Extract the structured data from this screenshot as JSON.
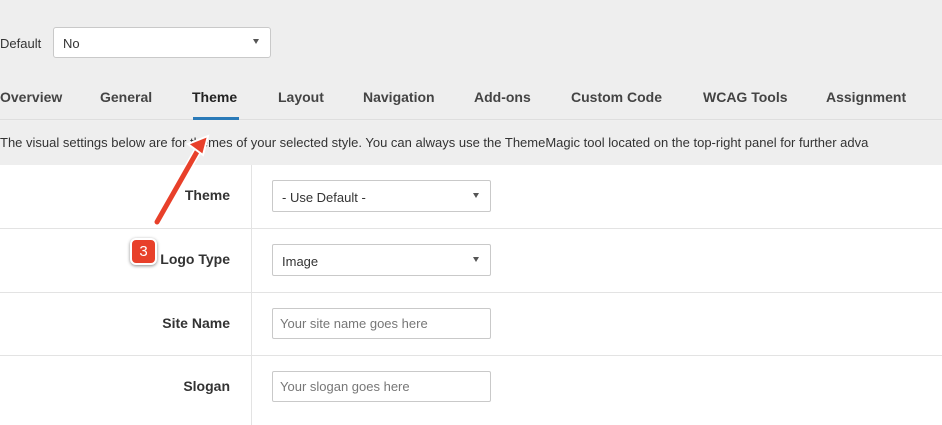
{
  "top": {
    "default_label": "Default",
    "default_value": "No"
  },
  "tabs": [
    {
      "label": "Overview"
    },
    {
      "label": "General"
    },
    {
      "label": "Theme"
    },
    {
      "label": "Layout"
    },
    {
      "label": "Navigation"
    },
    {
      "label": "Add-ons"
    },
    {
      "label": "Custom Code"
    },
    {
      "label": "WCAG Tools"
    },
    {
      "label": "Assignment"
    }
  ],
  "active_tab": "Theme",
  "info_text": "The visual settings below are for themes of your selected style. You can always use the ThemeMagic tool located on the top-right panel for further adva",
  "form": {
    "theme": {
      "label": "Theme",
      "value": "- Use Default -"
    },
    "logo_type": {
      "label": "Logo Type",
      "value": "Image"
    },
    "site_name": {
      "label": "Site Name",
      "placeholder": "Your site name goes here"
    },
    "slogan": {
      "label": "Slogan",
      "placeholder": "Your slogan goes here"
    }
  },
  "annotation": {
    "step_number": "3",
    "arrow_color": "#e8402a"
  },
  "colors": {
    "active_tab_underline": "#2a7ab8",
    "badge": "#e8402a"
  },
  "icons": [
    "chevron-down-icon",
    "annotation-arrow-icon"
  ]
}
